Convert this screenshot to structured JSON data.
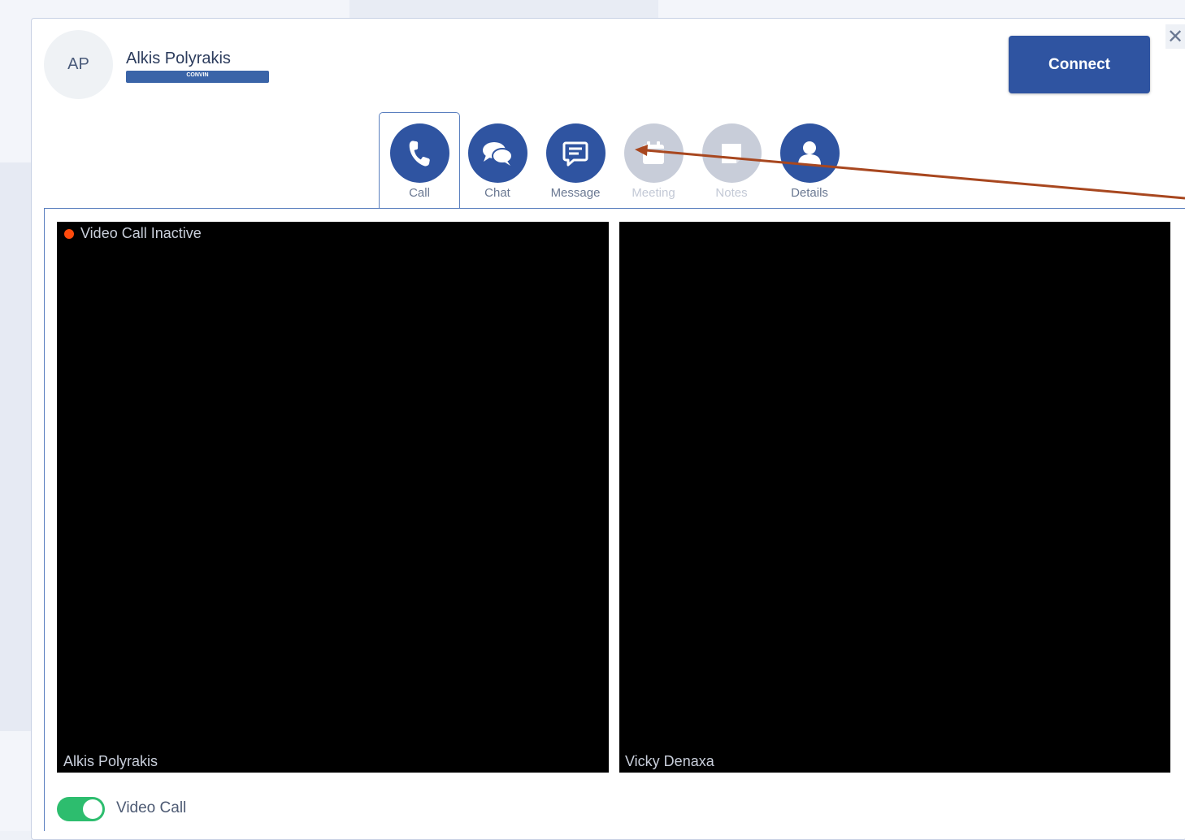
{
  "contact": {
    "initials": "AP",
    "name": "Alkis Polyrakis",
    "company": "CONVIN"
  },
  "header": {
    "connect_label": "Connect",
    "close_symbol": "✕"
  },
  "tabs": [
    {
      "label": "Call",
      "icon": "phone-icon",
      "active": true,
      "enabled": true
    },
    {
      "label": "Chat",
      "icon": "chat-bubbles-icon",
      "active": false,
      "enabled": true
    },
    {
      "label": "Message",
      "icon": "message-icon",
      "active": false,
      "enabled": true
    },
    {
      "label": "Meeting",
      "icon": "calendar-icon",
      "active": false,
      "enabled": false
    },
    {
      "label": "Notes",
      "icon": "notes-icon",
      "active": false,
      "enabled": false
    },
    {
      "label": "Details",
      "icon": "user-icon",
      "active": false,
      "enabled": true
    }
  ],
  "video": {
    "status_text": "Video Call Inactive",
    "left_participant": "Alkis Polyrakis",
    "right_participant": "Vicky Denaxa"
  },
  "toggle": {
    "label": "Video Call",
    "checked": true
  },
  "colors": {
    "accent": "#2f54a1",
    "disabled": "#c8cdd9",
    "status_dot": "#ff4a0c",
    "toggle_on": "#2dbd6e",
    "annotation_arrow": "#a8471f"
  }
}
